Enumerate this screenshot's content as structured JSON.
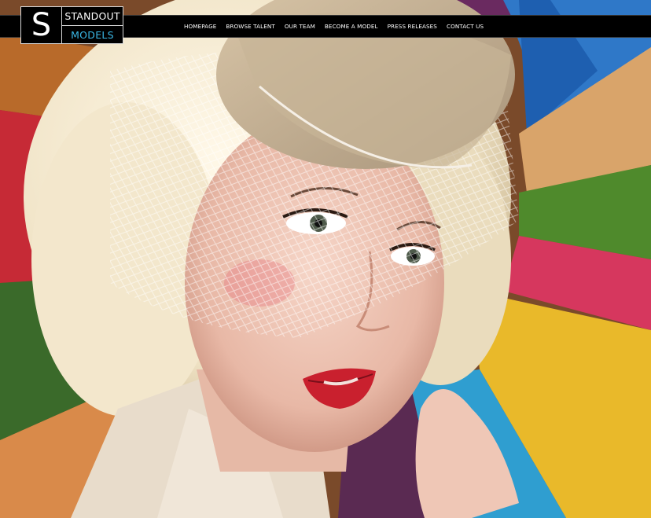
{
  "brand": {
    "mark": "S",
    "line1": "STANDOUT",
    "line2": "MODELS",
    "accent_color": "#3ab8e6"
  },
  "nav": {
    "items": [
      {
        "label": "HOMEPAGE"
      },
      {
        "label": "BROWSE TALENT"
      },
      {
        "label": "OUR TEAM"
      },
      {
        "label": "BECOME A MODEL"
      },
      {
        "label": "PRESS RELEASES"
      },
      {
        "label": "CONTACT US"
      }
    ]
  },
  "hero": {
    "icon": "hero-photo"
  }
}
